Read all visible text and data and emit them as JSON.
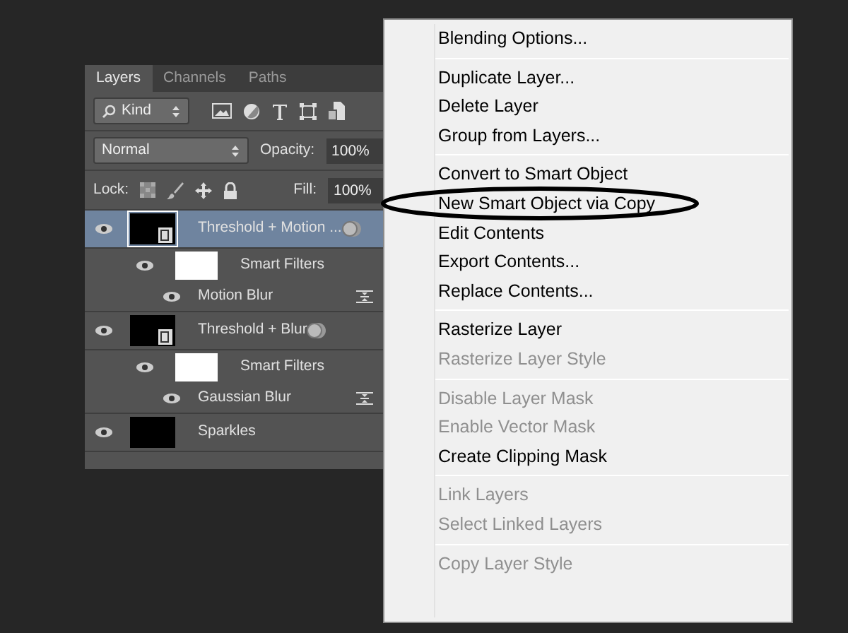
{
  "panel": {
    "tabs": [
      {
        "label": "Layers",
        "selected": true
      },
      {
        "label": "Channels",
        "selected": false
      },
      {
        "label": "Paths",
        "selected": false
      }
    ],
    "filter": {
      "value": "Kind"
    },
    "blend_mode": {
      "value": "Normal"
    },
    "opacity": {
      "label": "Opacity:",
      "value": "100%"
    },
    "lock_label": "Lock:",
    "fill": {
      "label": "Fill:",
      "value": "100%"
    },
    "layers": [
      {
        "name": "Threshold + Motion ...",
        "selected": true,
        "visible": true,
        "smart_object": true,
        "children": [
          {
            "name": "Smart Filters",
            "visible": true,
            "children": [
              {
                "name": "Motion Blur",
                "visible": true
              }
            ]
          }
        ]
      },
      {
        "name": "Threshold + Blur",
        "selected": false,
        "visible": true,
        "smart_object": true,
        "children": [
          {
            "name": "Smart Filters",
            "visible": true,
            "children": [
              {
                "name": "Gaussian Blur",
                "visible": true
              }
            ]
          }
        ]
      },
      {
        "name": "Sparkles",
        "selected": false,
        "visible": true,
        "smart_object": false
      }
    ]
  },
  "context_menu": {
    "groups": [
      [
        {
          "label": "Blending Options...",
          "disabled": false
        }
      ],
      [
        {
          "label": "Duplicate Layer...",
          "disabled": false
        },
        {
          "label": "Delete Layer",
          "disabled": false
        },
        {
          "label": "Group from Layers...",
          "disabled": false
        }
      ],
      [
        {
          "label": "Convert to Smart Object",
          "disabled": false
        },
        {
          "label": "New Smart Object via Copy",
          "disabled": false,
          "circled": true
        },
        {
          "label": "Edit Contents",
          "disabled": false
        },
        {
          "label": "Export Contents...",
          "disabled": false
        },
        {
          "label": "Replace Contents...",
          "disabled": false
        }
      ],
      [
        {
          "label": "Rasterize Layer",
          "disabled": false
        },
        {
          "label": "Rasterize Layer Style",
          "disabled": true
        }
      ],
      [
        {
          "label": "Disable Layer Mask",
          "disabled": true
        },
        {
          "label": "Enable Vector Mask",
          "disabled": true
        },
        {
          "label": "Create Clipping Mask",
          "disabled": false
        }
      ],
      [
        {
          "label": "Link Layers",
          "disabled": true
        },
        {
          "label": "Select Linked Layers",
          "disabled": true
        }
      ],
      [
        {
          "label": "Copy Layer Style",
          "disabled": true
        }
      ]
    ]
  }
}
